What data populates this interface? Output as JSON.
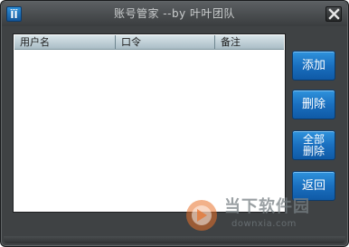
{
  "window": {
    "title": "账号管家 --by 叶叶团队",
    "icon_glyph": "ÏÏ"
  },
  "list": {
    "columns": [
      "用户名",
      "口令",
      "备注"
    ],
    "rows": []
  },
  "buttons": {
    "add": "添加",
    "delete": "删除",
    "delete_all_line1": "全部",
    "delete_all_line2": "删除",
    "back": "返回"
  },
  "watermark": {
    "text": "当下软件园",
    "url": "downxia.com"
  },
  "colors": {
    "window_bg": "#3f4244",
    "button_blue": "#1a6fbf",
    "header_bg": "#c3d3da",
    "watermark_orange": "#e8712a"
  }
}
